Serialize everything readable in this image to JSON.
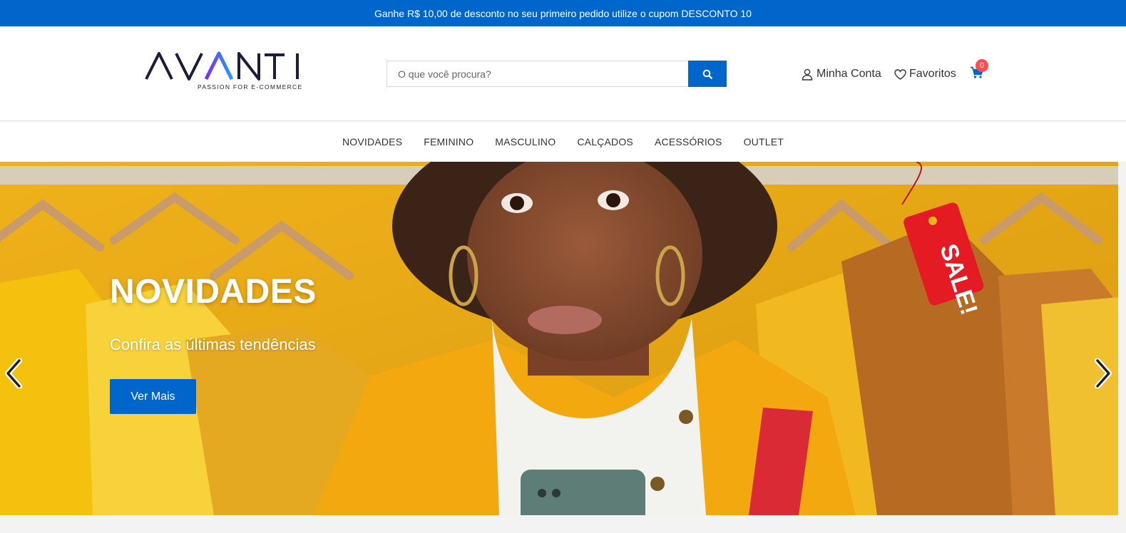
{
  "topbar": {
    "promo_text": "Ganhe R$ 10,00 de desconto no seu primeiro pedido utilize o cupom DESCONTO 10"
  },
  "header": {
    "logo_text": "AVANTI",
    "logo_tagline": "PASSION FOR E-COMMERCE",
    "search": {
      "placeholder": "O que você procura?",
      "value": ""
    },
    "account_label": "Minha Conta",
    "favorites_label": "Favoritos",
    "cart_count": "0"
  },
  "nav": {
    "items": [
      {
        "label": "NOVIDADES"
      },
      {
        "label": "FEMININO"
      },
      {
        "label": "MASCULINO"
      },
      {
        "label": "CALÇADOS"
      },
      {
        "label": "ACESSÓRIOS"
      },
      {
        "label": "OUTLET"
      }
    ]
  },
  "hero": {
    "title": "NOVIDADES",
    "subtitle": "Confira as últimas tendências",
    "button_label": "Ver Mais",
    "sale_tag_text": "SALE!"
  },
  "colors": {
    "primary": "#0066cc",
    "badge": "#ff4d4d",
    "hero_background": "#e6a714"
  },
  "icons": {
    "search": "search-icon",
    "user": "user-icon",
    "heart": "heart-icon",
    "cart": "cart-icon",
    "prev": "chevron-left-icon",
    "next": "chevron-right-icon"
  }
}
